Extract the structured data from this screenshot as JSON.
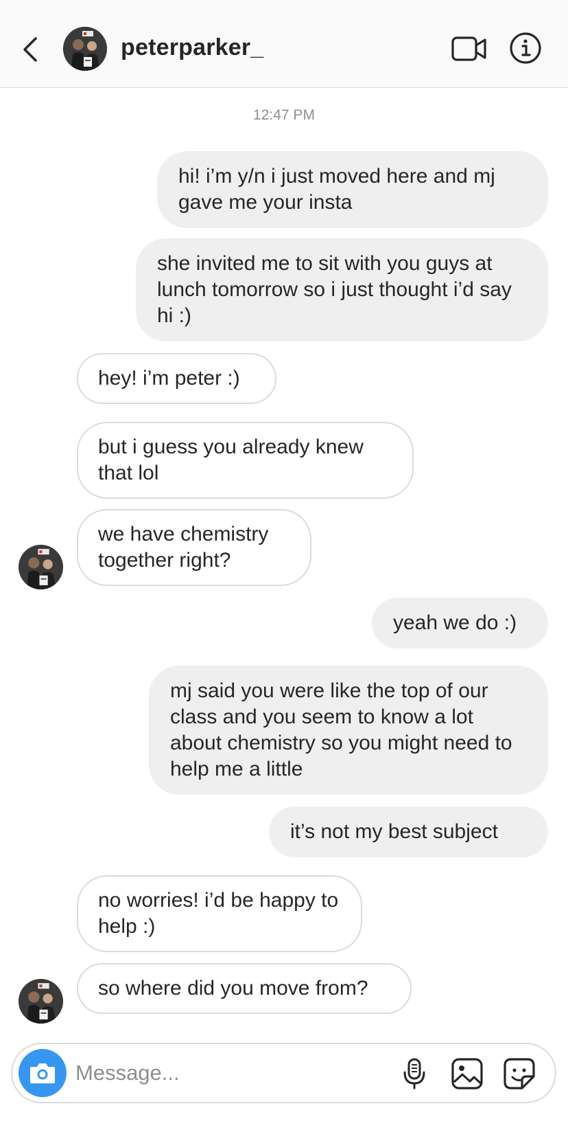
{
  "header": {
    "username": "peterparker_",
    "back_icon": "chevron-left-icon",
    "video_icon": "video-camera-icon",
    "info_icon": "info-icon"
  },
  "thread": {
    "timestamp": "12:47 PM",
    "messages": [
      {
        "sender": "me",
        "text": "hi! i’m y/n i just moved here and mj gave me your insta"
      },
      {
        "sender": "me",
        "text": "she invited me to sit with you guys at lunch tomorrow so i just thought i’d say hi :)"
      },
      {
        "sender": "peterparker_",
        "text": "hey! i’m peter :)"
      },
      {
        "sender": "peterparker_",
        "text": "but i guess you already knew that lol"
      },
      {
        "sender": "peterparker_",
        "text": "we have chemistry together right?"
      },
      {
        "sender": "me",
        "text": "yeah we do :)"
      },
      {
        "sender": "me",
        "text": "mj said you were like the top of our class and you seem to know a lot about chemistry so you might need to help me a little"
      },
      {
        "sender": "me",
        "text": "it’s not my best subject"
      },
      {
        "sender": "peterparker_",
        "text": "no worries! i’d be happy to help :)"
      },
      {
        "sender": "peterparker_",
        "text": "so where did you move from?"
      }
    ]
  },
  "composer": {
    "placeholder": "Message...",
    "value": "",
    "camera_icon": "camera-icon",
    "mic_icon": "microphone-icon",
    "gallery_icon": "image-gallery-icon",
    "sticker_icon": "sticker-icon"
  },
  "colors": {
    "outgoing_bubble": "#efefef",
    "incoming_border": "#dbdbdb",
    "camera_button": "#3797f0",
    "text": "#262626",
    "muted_text": "#8e8e8e"
  }
}
